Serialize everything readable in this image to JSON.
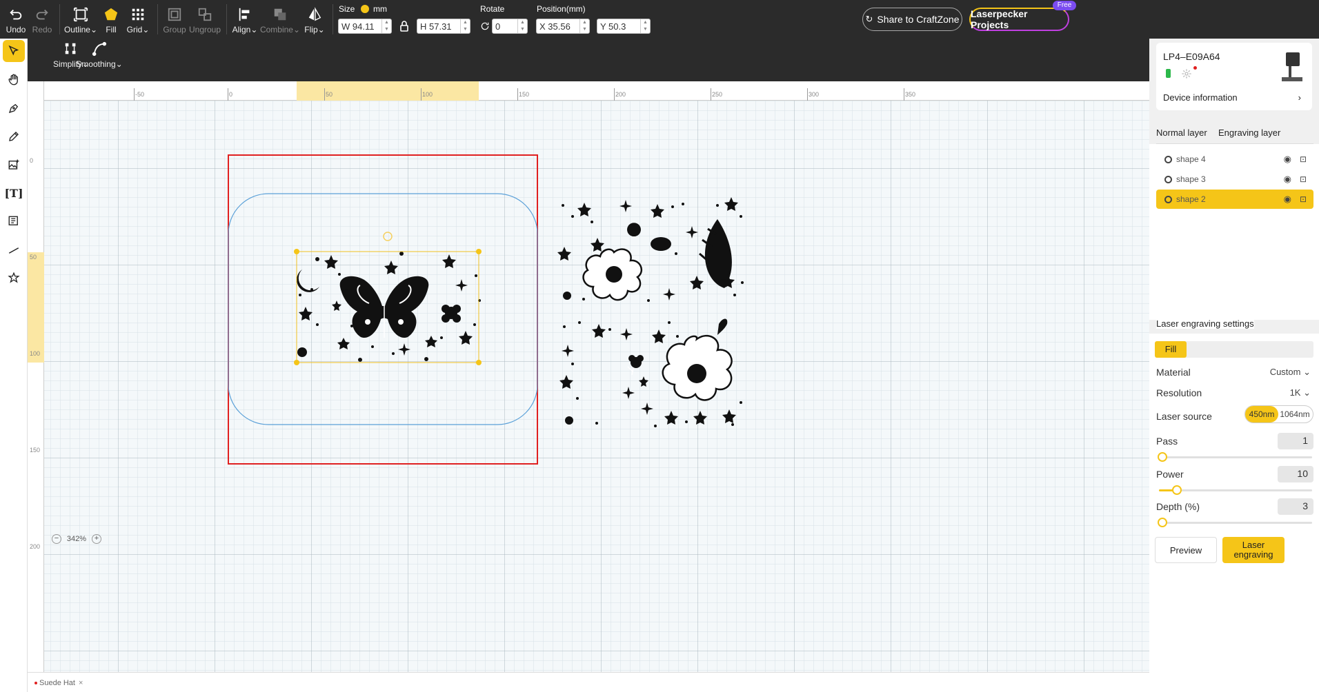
{
  "toolbar": {
    "undo": "Undo",
    "redo": "Redo",
    "outline": "Outline",
    "fill": "Fill",
    "grid": "Grid",
    "group": "Group",
    "ungroup": "Ungroup",
    "align": "Align",
    "combine": "Combine",
    "flip": "Flip",
    "size_label": "Size",
    "unit": "mm",
    "width": "W 94.11",
    "height": "H 57.31",
    "rotate_label": "Rotate",
    "rotate": "0",
    "position_label": "Position(mm)",
    "pos_x": "X 35.56",
    "pos_y": "Y 50.3",
    "share": "Share to CraftZone",
    "projects": "Laserpecker Projects",
    "free_badge": "Free"
  },
  "subtoolbar": {
    "simplify": "Simplify",
    "smoothing": "Smoothing"
  },
  "ruler": {
    "top": [
      "-50",
      "0",
      "50",
      "100",
      "150",
      "200",
      "250",
      "300",
      "350"
    ],
    "left": [
      "0",
      "50",
      "100",
      "150",
      "200"
    ]
  },
  "zoom": "342%",
  "file_tab": "Suede Hat",
  "device": {
    "name": "LP4–E09A64",
    "info_label": "Device information"
  },
  "layers": {
    "tabs": [
      "Normal layer",
      "Engraving layer"
    ],
    "items": [
      {
        "label": "shape 4",
        "selected": false
      },
      {
        "label": "shape 3",
        "selected": false
      },
      {
        "label": "shape 2",
        "selected": true
      }
    ]
  },
  "settings": {
    "title": "Laser engraving settings",
    "mode": "Fill",
    "material_label": "Material",
    "material": "Custom",
    "resolution_label": "Resolution",
    "resolution": "1K",
    "laser_source_label": "Laser source",
    "laser_sources": [
      "450nm",
      "1064nm"
    ],
    "laser_source_selected": "450nm",
    "pass_label": "Pass",
    "pass": "1",
    "pass_level": 0.0,
    "power_label": "Power",
    "power": "10",
    "power_level": 0.1,
    "depth_label": "Depth (%)",
    "depth": "3",
    "depth_level": 0.0,
    "preview": "Preview",
    "engrave": "Laser engraving"
  },
  "colors": {
    "accent": "#f5c518",
    "toolbar": "#2b2b2b",
    "frame": "#e02020",
    "hat_outline": "#5aa0d8"
  }
}
